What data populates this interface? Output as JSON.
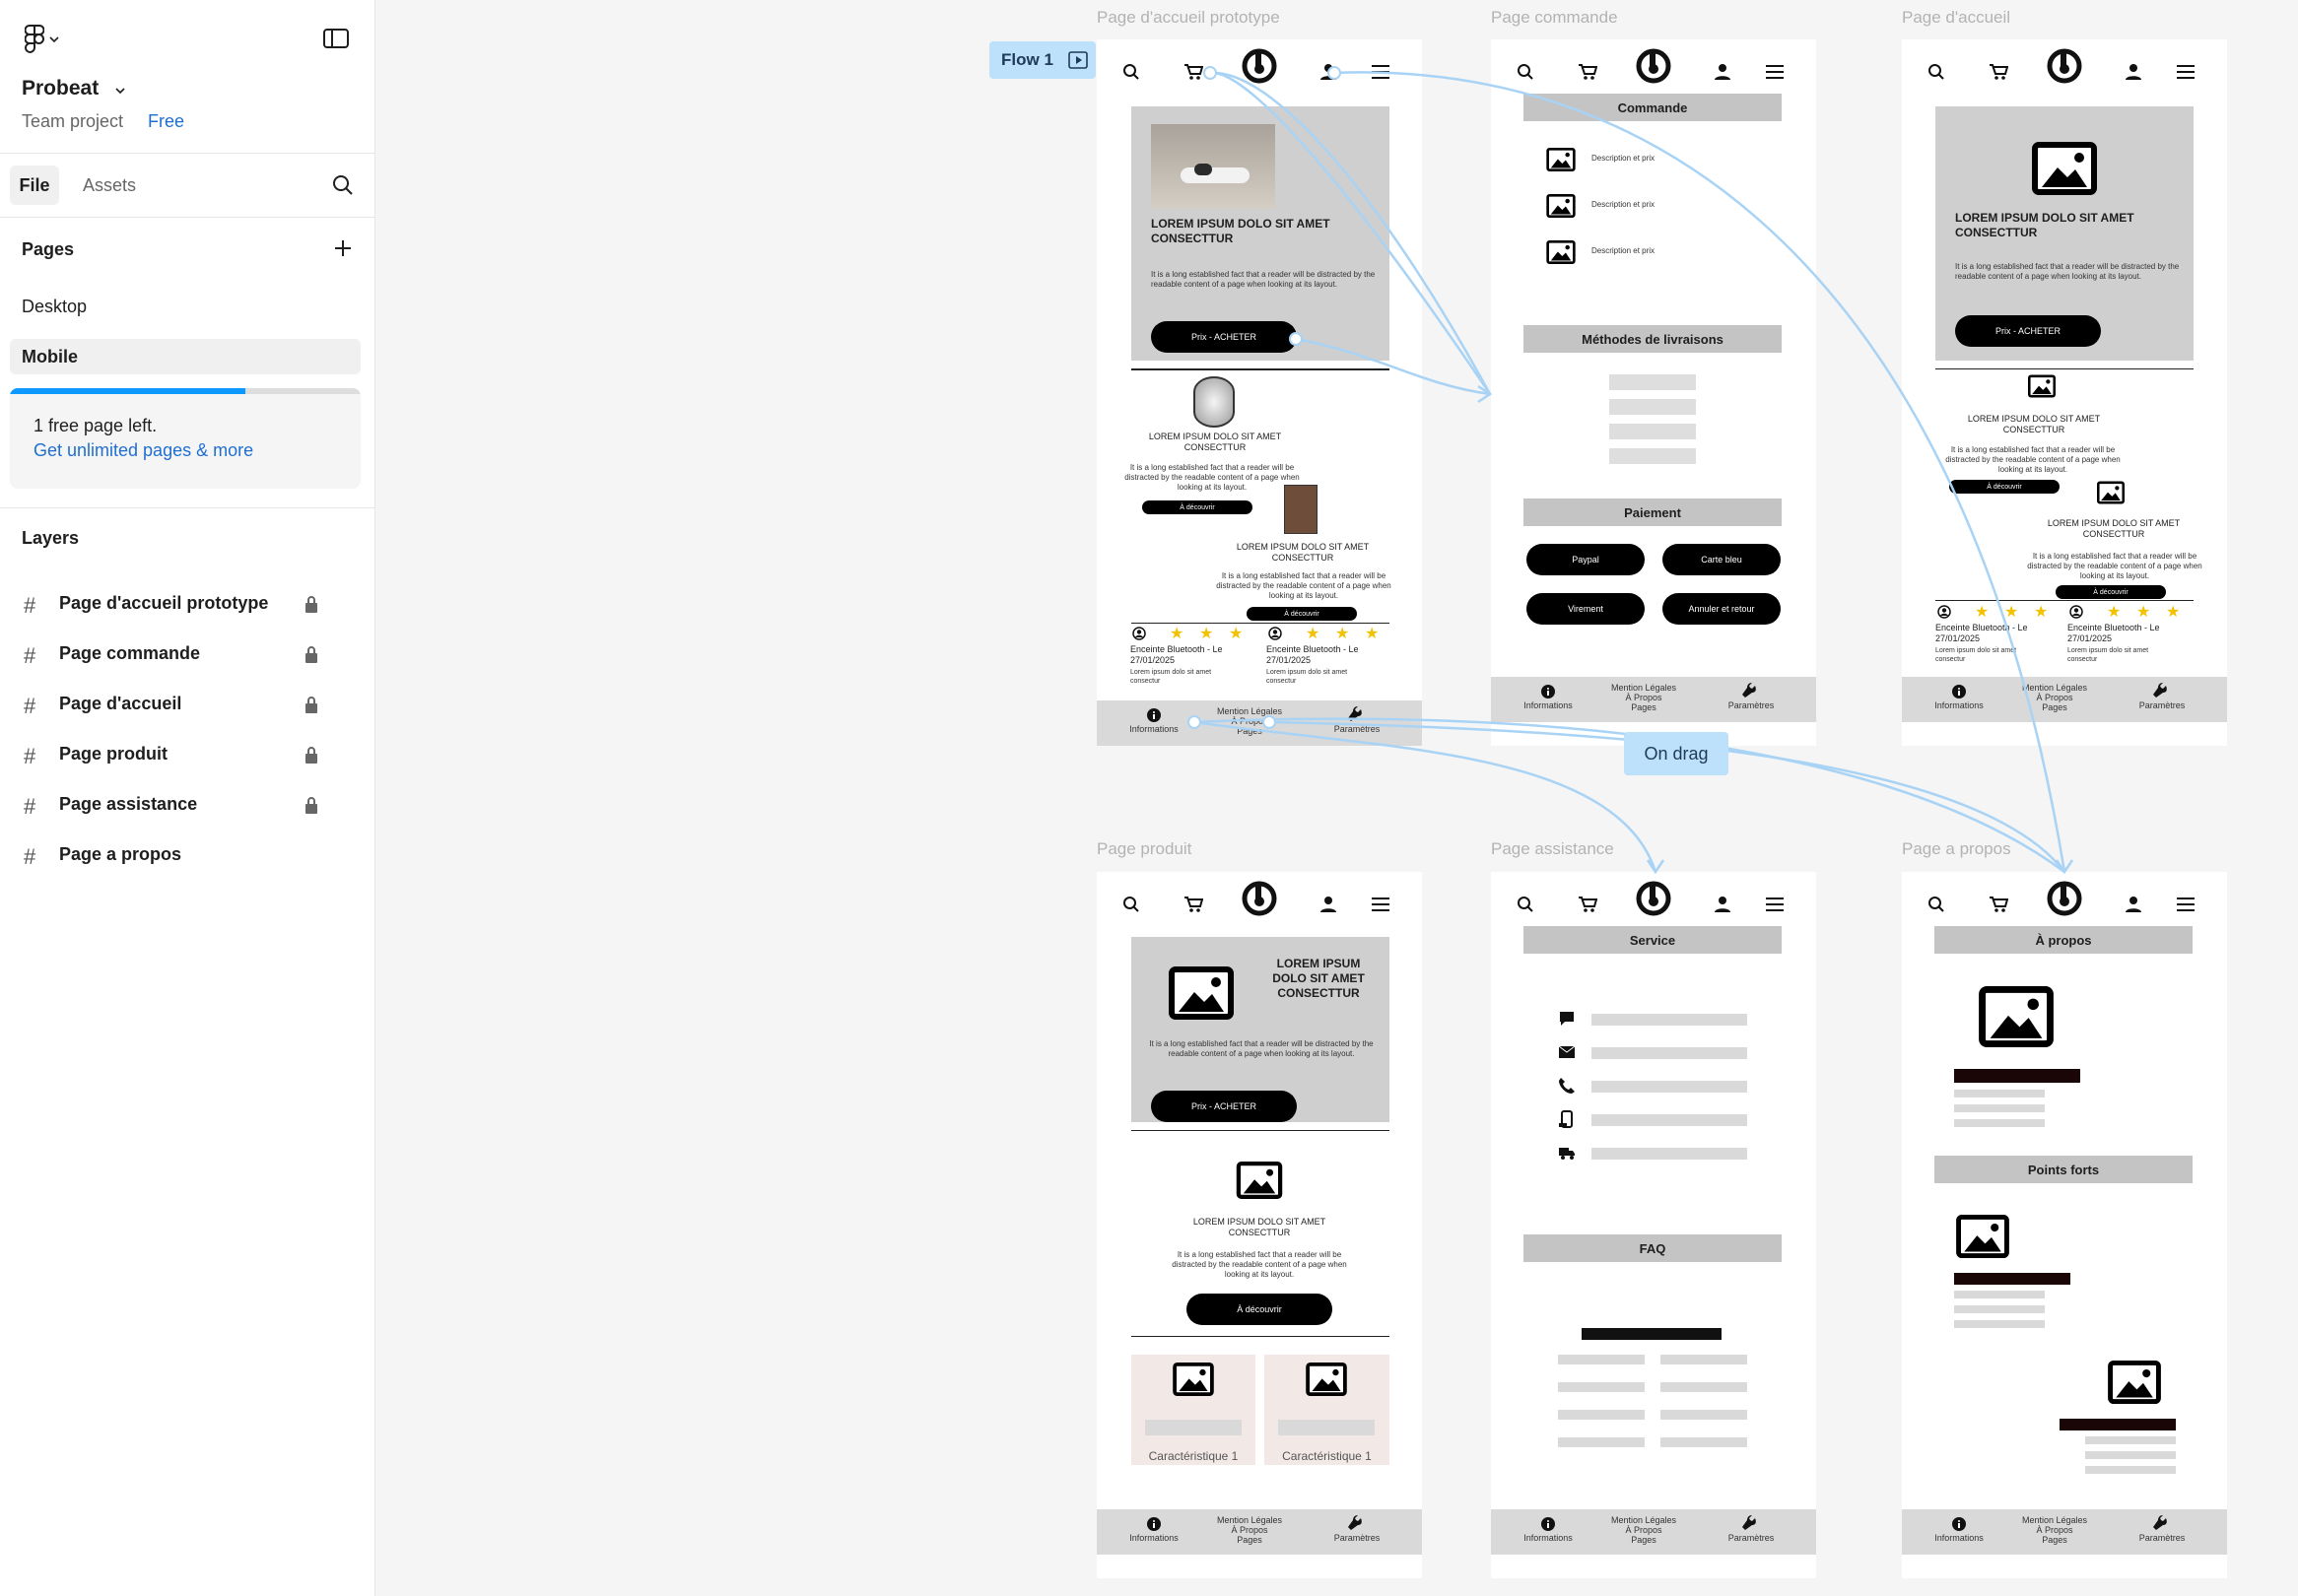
{
  "sidebar": {
    "project_name": "Probeat",
    "project_sub": "Team project",
    "plan_badge": "Free",
    "tabs": [
      "File",
      "Assets"
    ],
    "pages_title": "Pages",
    "pages": [
      "Desktop",
      "Mobile"
    ],
    "upsell_line1": "1 free page left.",
    "upsell_link": "Get unlimited pages & more",
    "layers_title": "Layers",
    "layers": [
      "Page d'accueil prototype",
      "Page commande",
      "Page d'accueil",
      "Page produit",
      "Page assistance",
      "Page a propos"
    ]
  },
  "canvas": {
    "flow_label": "Flow 1",
    "on_drag_label": "On drag",
    "frames": [
      "Page d'accueil prototype",
      "Page commande",
      "Page d'accueil",
      "Page produit",
      "Page assistance",
      "Page a propos"
    ],
    "hero_title": "LOREM IPSUM DOLO SIT AMET CONSECTTUR",
    "hero_text": "It is a long established fact that a reader will be distracted by the readable content of a page when looking at its layout.",
    "buy_btn": "Prix - ACHETER",
    "discover_btn": "À découvrir",
    "review_title": "Enceinte Bluetooth - Le 27/01/2025",
    "review_text": "Lorem ipsum dolo sit amet consectur",
    "footer": {
      "info": "Informations",
      "mid": "Mention Légales\nÀ Propos\nPages",
      "settings": "Paramètres"
    },
    "commande": {
      "title": "Commande",
      "desc": "Description et prix",
      "delivery": "Méthodes de livraisons",
      "payment": "Paiement",
      "buttons": [
        "Paypal",
        "Carte bleu",
        "Virement",
        "Annuler et retour"
      ]
    },
    "produit": {
      "feature": "Caractéristique 1"
    },
    "assistance": {
      "service": "Service",
      "faq": "FAQ"
    },
    "apropos": {
      "title": "À propos",
      "strengths": "Points forts"
    },
    "link_color": "#a9d3f5",
    "selection_color": "#bde0fb"
  }
}
